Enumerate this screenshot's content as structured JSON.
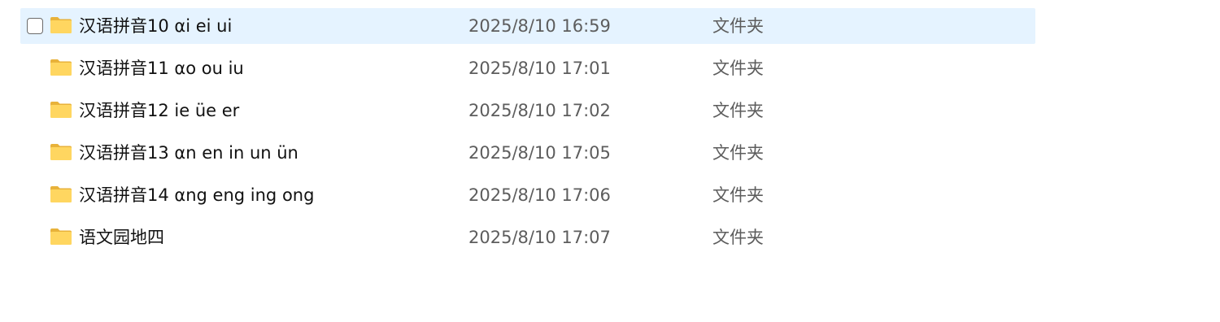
{
  "rows": [
    {
      "name": "汉语拼音10 αi ei ui",
      "date": "2025/8/10 16:59",
      "type": "文件夹",
      "selected": true,
      "icon": "folder-icon"
    },
    {
      "name": "汉语拼音11 αo ou iu",
      "date": "2025/8/10 17:01",
      "type": "文件夹",
      "selected": false,
      "icon": "folder-icon"
    },
    {
      "name": "汉语拼音12 ie üe er",
      "date": "2025/8/10 17:02",
      "type": "文件夹",
      "selected": false,
      "icon": "folder-icon"
    },
    {
      "name": "汉语拼音13 αn en in un ün",
      "date": "2025/8/10 17:05",
      "type": "文件夹",
      "selected": false,
      "icon": "folder-icon"
    },
    {
      "name": "汉语拼音14 αng eng ing ong",
      "date": "2025/8/10 17:06",
      "type": "文件夹",
      "selected": false,
      "icon": "folder-icon"
    },
    {
      "name": "语文园地四",
      "date": "2025/8/10 17:07",
      "type": "文件夹",
      "selected": false,
      "icon": "folder-icon"
    }
  ],
  "colors": {
    "selected_row_bg": "#e5f3ff",
    "folder_back": "#e8b23a",
    "folder_front": "#ffd660"
  }
}
